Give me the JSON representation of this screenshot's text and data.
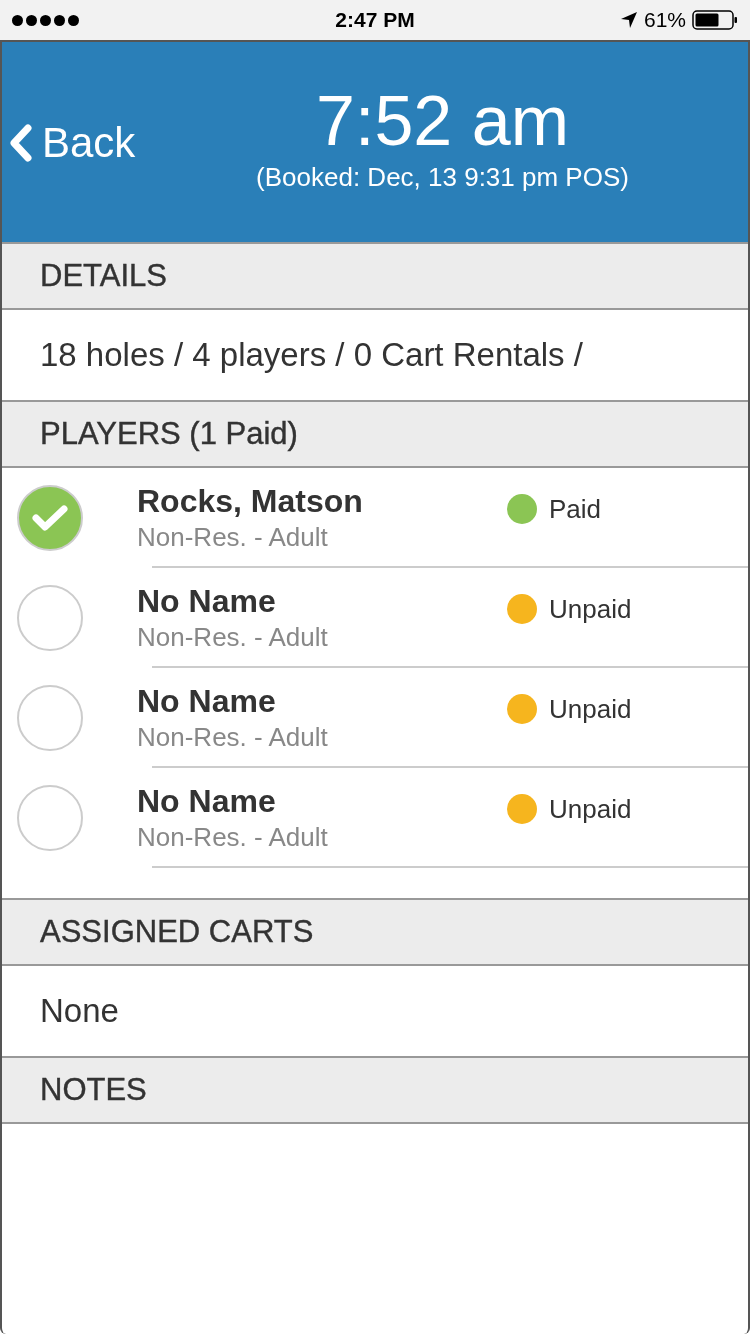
{
  "status_bar": {
    "time": "2:47 PM",
    "battery": "61%"
  },
  "header": {
    "back": "Back",
    "time": "7:52 am",
    "booked": "(Booked: Dec, 13 9:31 pm POS)"
  },
  "details": {
    "title": "DETAILS",
    "text": "18 holes / 4 players / 0 Cart Rentals /"
  },
  "players": {
    "title": "PLAYERS (1 Paid)",
    "items": [
      {
        "name": "Rocks, Matson",
        "type": "Non-Res. - Adult",
        "checked": true,
        "status": "Paid",
        "color": "#8bc554"
      },
      {
        "name": "No Name",
        "type": "Non-Res. - Adult",
        "checked": false,
        "status": "Unpaid",
        "color": "#f6b51e"
      },
      {
        "name": "No Name",
        "type": "Non-Res. - Adult",
        "checked": false,
        "status": "Unpaid",
        "color": "#f6b51e"
      },
      {
        "name": "No Name",
        "type": "Non-Res. - Adult",
        "checked": false,
        "status": "Unpaid",
        "color": "#f6b51e"
      }
    ]
  },
  "carts": {
    "title": "ASSIGNED CARTS",
    "text": "None"
  },
  "notes": {
    "title": "NOTES"
  }
}
